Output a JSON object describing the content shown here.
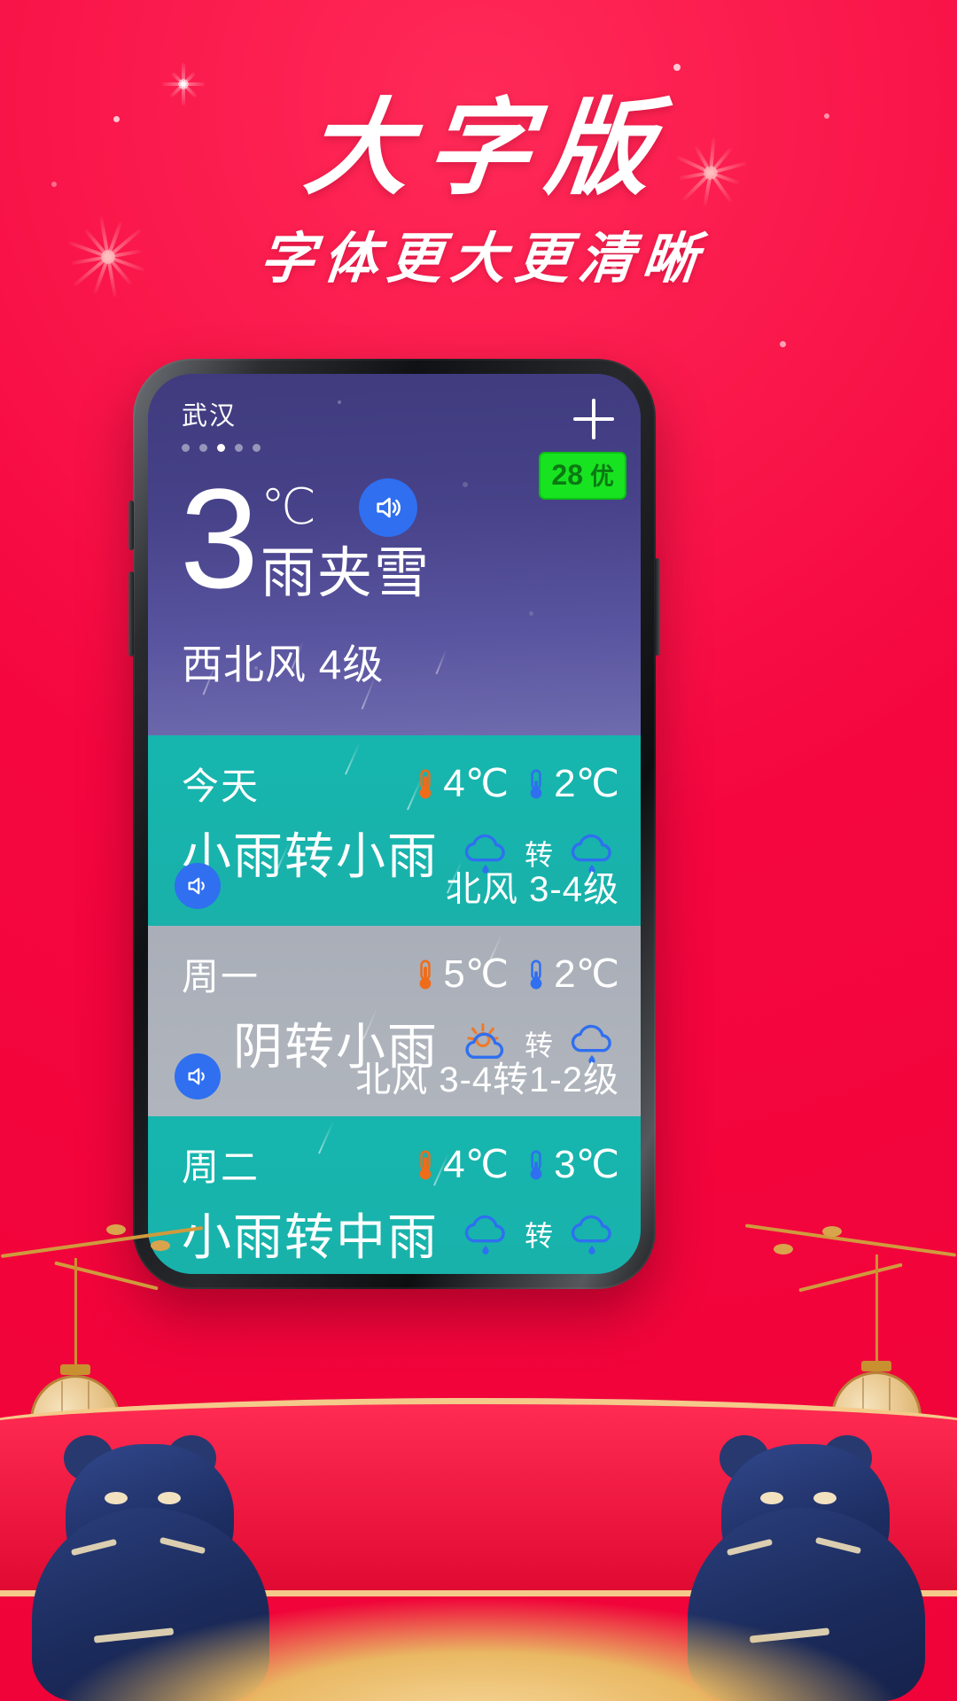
{
  "poster": {
    "headline": "大字版",
    "subline": "字体更大更清晰",
    "background_color": "#f5063f",
    "headline_color": "#ffffff"
  },
  "phone": {
    "app": {
      "header": {
        "city": "武汉",
        "page_dots_total": 5,
        "page_dots_active_index": 2,
        "add_button_label": "+"
      },
      "current": {
        "temperature": "3",
        "unit": "℃",
        "condition": "雨夹雪",
        "wind": "西北风 4级",
        "speak_icon": "speaker-icon",
        "aqi_value": "28",
        "aqi_level": "优",
        "aqi_color": "#18e321"
      },
      "forecast_rows": [
        {
          "day": "今天",
          "high": "4℃",
          "low": "2℃",
          "high_icon": "thermometer-high-icon",
          "low_icon": "thermometer-low-icon",
          "condition": "小雨转小雨",
          "icon_left": "rain-cloud-icon",
          "turn_label": "转",
          "icon_right": "rain-cloud-icon",
          "wind": "北风 3-4级",
          "speak_icon": "speaker-icon",
          "theme": "teal"
        },
        {
          "day": "周一",
          "high": "5℃",
          "low": "2℃",
          "high_icon": "thermometer-high-icon",
          "low_icon": "thermometer-low-icon",
          "condition": "阴转小雨",
          "icon_left": "sun-behind-cloud-icon",
          "turn_label": "转",
          "icon_right": "rain-cloud-icon",
          "wind": "北风 3-4转1-2级",
          "speak_icon": "speaker-icon",
          "theme": "grey"
        },
        {
          "day": "周二",
          "high": "4℃",
          "low": "3℃",
          "high_icon": "thermometer-high-icon",
          "low_icon": "thermometer-low-icon",
          "condition": "小雨转中雨",
          "icon_left": "rain-cloud-icon",
          "turn_label": "转",
          "icon_right": "rain-cloud-icon",
          "wind": "",
          "speak_icon": "speaker-icon",
          "theme": "teal"
        }
      ]
    }
  }
}
